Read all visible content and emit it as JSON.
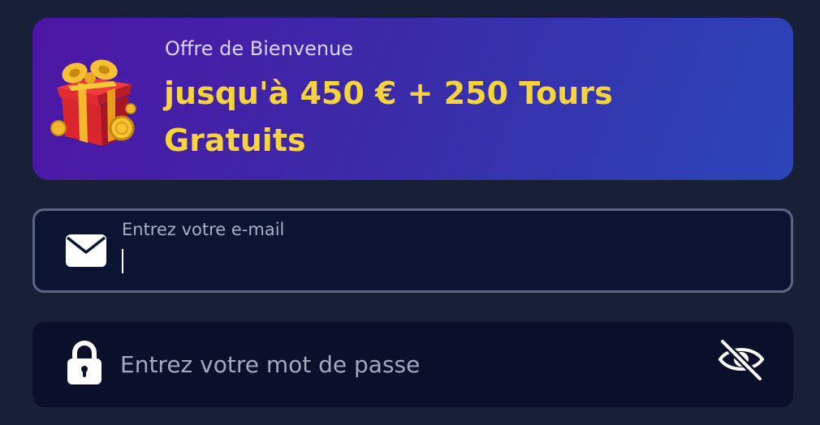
{
  "banner": {
    "subtitle": "Offre de Bienvenue",
    "title": "jusqu'à 450 € + 250 Tours Gratuits"
  },
  "email_field": {
    "label": "Entrez votre e-mail",
    "value": ""
  },
  "password_field": {
    "placeholder": "Entrez votre mot de passe",
    "value": ""
  },
  "icons": {
    "gift": "gift-icon",
    "mail": "mail-icon",
    "lock": "lock-icon",
    "visibility": "eye-off-icon"
  },
  "colors": {
    "background": "#182038",
    "banner_start": "#4e16a6",
    "banner_end": "#2b45b8",
    "title_accent": "#f7d43a",
    "field_bg": "#0b1430",
    "field_border": "#5b6480"
  }
}
